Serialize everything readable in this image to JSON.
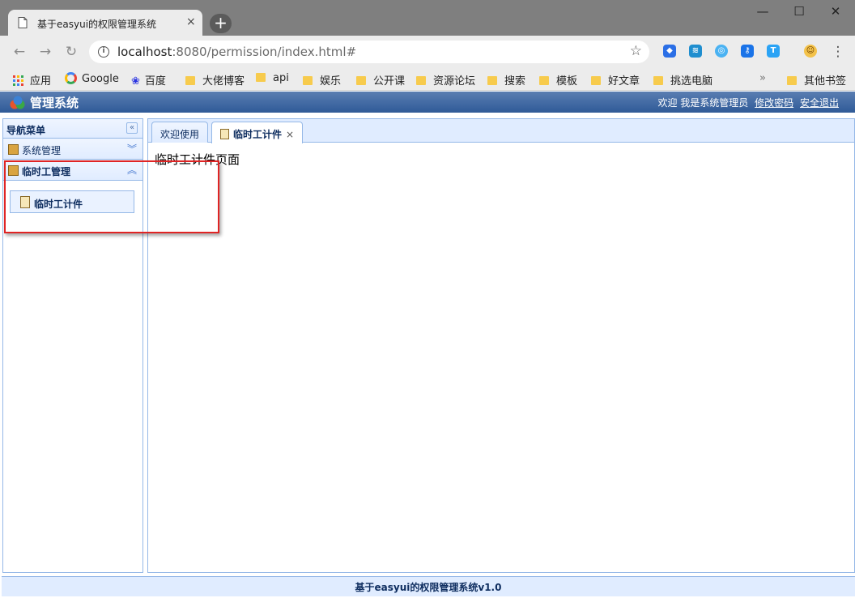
{
  "browser": {
    "tab_title": "基于easyui的权限管理系统",
    "tab_close": "×",
    "new_tab": "+",
    "window_controls": {
      "minimize": "—",
      "maximize": "☐",
      "close": "✕"
    },
    "nav": {
      "back": "←",
      "forward": "→",
      "reload": "↻"
    },
    "url_host": "localhost",
    "url_rest": ":8080/permission/index.html#",
    "info_icon": "i",
    "star": "☆",
    "menu_dots": "⋮",
    "extensions": [
      "blue-square-ext-icon",
      "swirl-ext-icon",
      "globe-ext-icon",
      "key-ext-icon",
      "t-ext-icon",
      "emoji-avatar-icon"
    ],
    "bookmarks": [
      {
        "label": "应用",
        "icon": "apps-grid-icon"
      },
      {
        "label": "Google",
        "icon": "google-g-icon"
      },
      {
        "label": "百度",
        "icon": "baidu-paw-icon"
      },
      {
        "label": "大佬博客",
        "icon": "folder-icon"
      },
      {
        "label": "api",
        "icon": "folder-icon"
      },
      {
        "label": "娱乐",
        "icon": "folder-icon"
      },
      {
        "label": "公开课",
        "icon": "folder-icon"
      },
      {
        "label": "资源论坛",
        "icon": "folder-icon"
      },
      {
        "label": "搜索",
        "icon": "folder-icon"
      },
      {
        "label": "模板",
        "icon": "folder-icon"
      },
      {
        "label": "好文章",
        "icon": "folder-icon"
      },
      {
        "label": "挑选电脑",
        "icon": "folder-icon"
      }
    ],
    "bookmarks_more": "»",
    "other_bookmarks": "其他书签"
  },
  "app": {
    "title": "管理系统",
    "welcome": "欢迎 我是系统管理员",
    "change_password": "修改密码",
    "logout": "安全退出",
    "sidebar": {
      "title": "导航菜单",
      "collapse": "«",
      "groups": [
        {
          "label": "系统管理",
          "chevron": "︾"
        },
        {
          "label": "临时工管理",
          "chevron": "︽"
        }
      ],
      "items": [
        {
          "label": "临时工计件"
        }
      ]
    },
    "tabs": [
      {
        "label": "欢迎使用"
      },
      {
        "label": "临时工计件",
        "close": "×"
      }
    ],
    "content_text": "临时工计件页面",
    "footer": "基于easyui的权限管理系统v1.0"
  },
  "colors": {
    "header_top": "#5a7eb2",
    "header_bottom": "#2f5a97",
    "panel_border": "#95b8e7",
    "panel_bg": "#e0ecff",
    "annotation_red": "#e02424"
  }
}
